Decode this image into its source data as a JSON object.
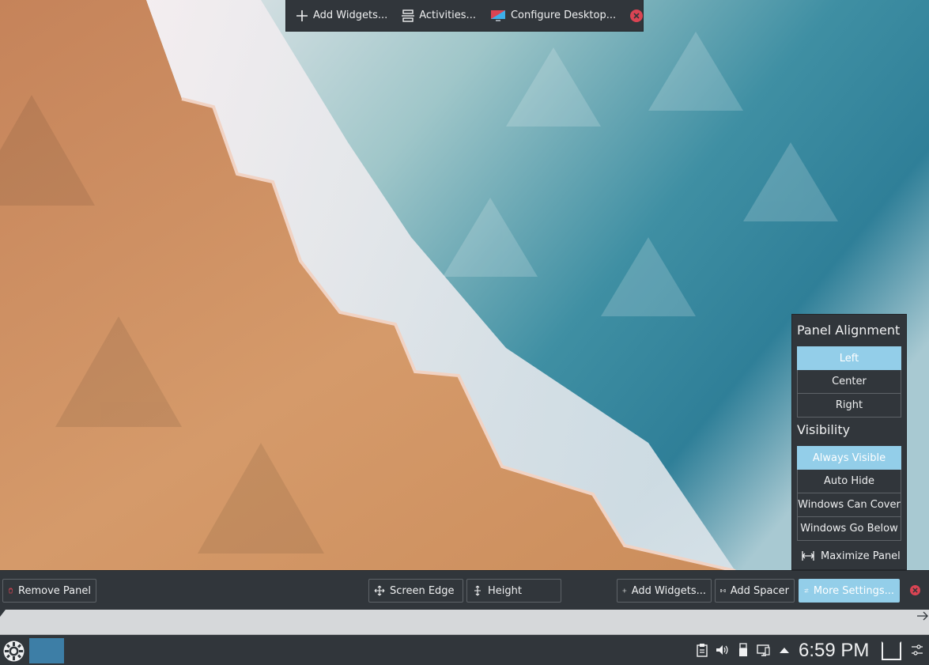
{
  "desktop_toolbar": {
    "add_widgets": "Add Widgets...",
    "activities": "Activities...",
    "configure_desktop": "Configure Desktop..."
  },
  "more_settings": {
    "alignment_title": "Panel Alignment",
    "alignment_options": [
      "Left",
      "Center",
      "Right"
    ],
    "alignment_selected": "Left",
    "visibility_title": "Visibility",
    "visibility_options": [
      "Always Visible",
      "Auto Hide",
      "Windows Can Cover",
      "Windows Go Below"
    ],
    "visibility_selected": "Always Visible",
    "maximize": "Maximize Panel"
  },
  "panel_config": {
    "remove_panel": "Remove Panel",
    "screen_edge": "Screen Edge",
    "height": "Height",
    "add_widgets": "Add Widgets...",
    "add_spacer": "Add Spacer",
    "more_settings": "More Settings..."
  },
  "taskbar": {
    "clock": "6:59 PM"
  },
  "colors": {
    "accent": "#93cee9",
    "close_red": "#da4453",
    "panel_bg": "#31363b",
    "task_highlight": "#3d7ea6"
  }
}
